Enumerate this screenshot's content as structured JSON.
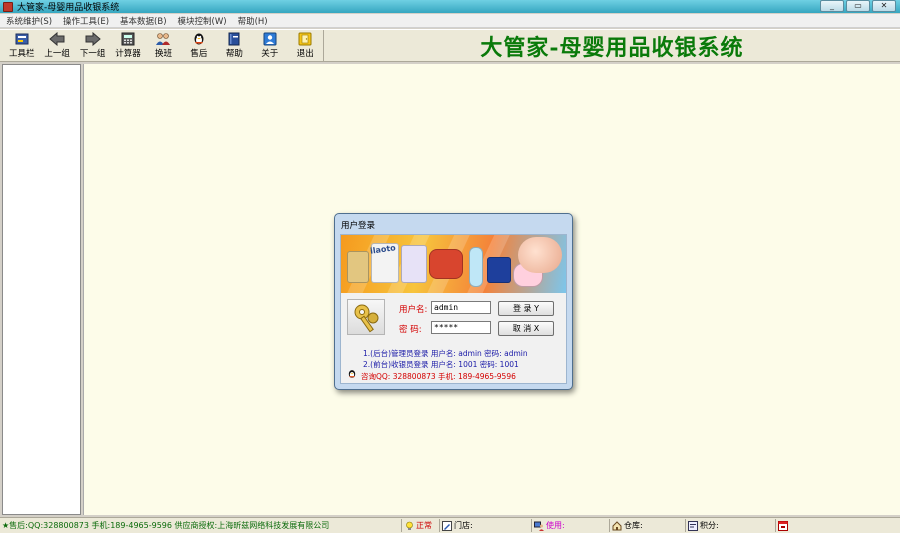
{
  "window": {
    "title": "大管家-母婴用品收银系统",
    "controls": [
      "_",
      "▭",
      "✕"
    ]
  },
  "menu": [
    {
      "label": "系统维护(S)"
    },
    {
      "label": "操作工具(E)"
    },
    {
      "label": "基本数据(B)"
    },
    {
      "label": "模块控制(W)"
    },
    {
      "label": "帮助(H)"
    }
  ],
  "toolbar": {
    "items": [
      {
        "label": "工具栏",
        "icon": "toolbar-icon"
      },
      {
        "label": "上一组",
        "icon": "arrow-left-icon"
      },
      {
        "label": "下一组",
        "icon": "arrow-right-icon"
      },
      {
        "label": "计算器",
        "icon": "calculator-icon"
      },
      {
        "label": "换班",
        "icon": "users-icon"
      },
      {
        "label": "售后",
        "icon": "qq-penguin-icon"
      },
      {
        "label": "帮助",
        "icon": "book-icon"
      },
      {
        "label": "关于",
        "icon": "user-card-icon"
      },
      {
        "label": "退出",
        "icon": "exit-icon"
      }
    ],
    "banner_title": "大管家-母婴用品收银系统"
  },
  "login": {
    "title": "用户登录",
    "promo_brand": "ilaoto",
    "username_label": "用户名:",
    "username_value": "admin",
    "password_label": "密  码:",
    "password_value": "*****",
    "login_button": "登 录 Y",
    "cancel_button": "取 消 X",
    "info_line1": "1.(后台)管理员登录  用户名: admin   密码: admin",
    "info_line2": "2.(前台)收银员登录  用户名: 1001    密码: 1001",
    "contact": "咨询QQ: 328800873    手机: 189-4965-9596"
  },
  "status": {
    "vendor": "★售后:QQ:328800873 手机:189-4965-9596 供应商授权:上海昕兹网络科技发展有限公司",
    "state": "正常",
    "store": "门店:",
    "user": "使用:",
    "warehouse": "仓库:",
    "points": "积分:"
  },
  "colors": {
    "banner_title": "#0a7a0a",
    "workspace_bg": "#fdfce9",
    "label_red": "#d40000",
    "info_blue": "#1a1aa8"
  }
}
